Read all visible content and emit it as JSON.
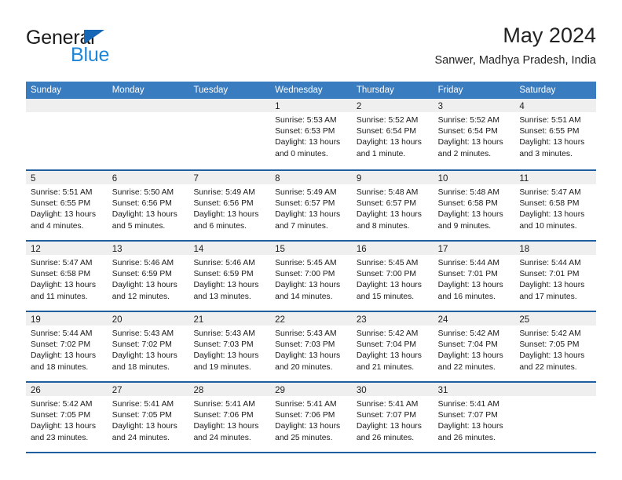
{
  "brand": {
    "name_part1": "General",
    "name_part2": "Blue",
    "triangle_color": "#1667b5",
    "blue_color": "#1e86d8"
  },
  "header": {
    "title": "May 2024",
    "subtitle": "Sanwer, Madhya Pradesh, India"
  },
  "theme": {
    "header_bg": "#3a7cc0",
    "row_border": "#1f5fa0",
    "day_band_bg": "#efefef"
  },
  "weekdays": [
    "Sunday",
    "Monday",
    "Tuesday",
    "Wednesday",
    "Thursday",
    "Friday",
    "Saturday"
  ],
  "weeks": [
    [
      {
        "day": "",
        "sunrise": "",
        "sunset": "",
        "daylight1": "",
        "daylight2": ""
      },
      {
        "day": "",
        "sunrise": "",
        "sunset": "",
        "daylight1": "",
        "daylight2": ""
      },
      {
        "day": "",
        "sunrise": "",
        "sunset": "",
        "daylight1": "",
        "daylight2": ""
      },
      {
        "day": "1",
        "sunrise": "Sunrise: 5:53 AM",
        "sunset": "Sunset: 6:53 PM",
        "daylight1": "Daylight: 13 hours",
        "daylight2": "and 0 minutes."
      },
      {
        "day": "2",
        "sunrise": "Sunrise: 5:52 AM",
        "sunset": "Sunset: 6:54 PM",
        "daylight1": "Daylight: 13 hours",
        "daylight2": "and 1 minute."
      },
      {
        "day": "3",
        "sunrise": "Sunrise: 5:52 AM",
        "sunset": "Sunset: 6:54 PM",
        "daylight1": "Daylight: 13 hours",
        "daylight2": "and 2 minutes."
      },
      {
        "day": "4",
        "sunrise": "Sunrise: 5:51 AM",
        "sunset": "Sunset: 6:55 PM",
        "daylight1": "Daylight: 13 hours",
        "daylight2": "and 3 minutes."
      }
    ],
    [
      {
        "day": "5",
        "sunrise": "Sunrise: 5:51 AM",
        "sunset": "Sunset: 6:55 PM",
        "daylight1": "Daylight: 13 hours",
        "daylight2": "and 4 minutes."
      },
      {
        "day": "6",
        "sunrise": "Sunrise: 5:50 AM",
        "sunset": "Sunset: 6:56 PM",
        "daylight1": "Daylight: 13 hours",
        "daylight2": "and 5 minutes."
      },
      {
        "day": "7",
        "sunrise": "Sunrise: 5:49 AM",
        "sunset": "Sunset: 6:56 PM",
        "daylight1": "Daylight: 13 hours",
        "daylight2": "and 6 minutes."
      },
      {
        "day": "8",
        "sunrise": "Sunrise: 5:49 AM",
        "sunset": "Sunset: 6:57 PM",
        "daylight1": "Daylight: 13 hours",
        "daylight2": "and 7 minutes."
      },
      {
        "day": "9",
        "sunrise": "Sunrise: 5:48 AM",
        "sunset": "Sunset: 6:57 PM",
        "daylight1": "Daylight: 13 hours",
        "daylight2": "and 8 minutes."
      },
      {
        "day": "10",
        "sunrise": "Sunrise: 5:48 AM",
        "sunset": "Sunset: 6:58 PM",
        "daylight1": "Daylight: 13 hours",
        "daylight2": "and 9 minutes."
      },
      {
        "day": "11",
        "sunrise": "Sunrise: 5:47 AM",
        "sunset": "Sunset: 6:58 PM",
        "daylight1": "Daylight: 13 hours",
        "daylight2": "and 10 minutes."
      }
    ],
    [
      {
        "day": "12",
        "sunrise": "Sunrise: 5:47 AM",
        "sunset": "Sunset: 6:58 PM",
        "daylight1": "Daylight: 13 hours",
        "daylight2": "and 11 minutes."
      },
      {
        "day": "13",
        "sunrise": "Sunrise: 5:46 AM",
        "sunset": "Sunset: 6:59 PM",
        "daylight1": "Daylight: 13 hours",
        "daylight2": "and 12 minutes."
      },
      {
        "day": "14",
        "sunrise": "Sunrise: 5:46 AM",
        "sunset": "Sunset: 6:59 PM",
        "daylight1": "Daylight: 13 hours",
        "daylight2": "and 13 minutes."
      },
      {
        "day": "15",
        "sunrise": "Sunrise: 5:45 AM",
        "sunset": "Sunset: 7:00 PM",
        "daylight1": "Daylight: 13 hours",
        "daylight2": "and 14 minutes."
      },
      {
        "day": "16",
        "sunrise": "Sunrise: 5:45 AM",
        "sunset": "Sunset: 7:00 PM",
        "daylight1": "Daylight: 13 hours",
        "daylight2": "and 15 minutes."
      },
      {
        "day": "17",
        "sunrise": "Sunrise: 5:44 AM",
        "sunset": "Sunset: 7:01 PM",
        "daylight1": "Daylight: 13 hours",
        "daylight2": "and 16 minutes."
      },
      {
        "day": "18",
        "sunrise": "Sunrise: 5:44 AM",
        "sunset": "Sunset: 7:01 PM",
        "daylight1": "Daylight: 13 hours",
        "daylight2": "and 17 minutes."
      }
    ],
    [
      {
        "day": "19",
        "sunrise": "Sunrise: 5:44 AM",
        "sunset": "Sunset: 7:02 PM",
        "daylight1": "Daylight: 13 hours",
        "daylight2": "and 18 minutes."
      },
      {
        "day": "20",
        "sunrise": "Sunrise: 5:43 AM",
        "sunset": "Sunset: 7:02 PM",
        "daylight1": "Daylight: 13 hours",
        "daylight2": "and 18 minutes."
      },
      {
        "day": "21",
        "sunrise": "Sunrise: 5:43 AM",
        "sunset": "Sunset: 7:03 PM",
        "daylight1": "Daylight: 13 hours",
        "daylight2": "and 19 minutes."
      },
      {
        "day": "22",
        "sunrise": "Sunrise: 5:43 AM",
        "sunset": "Sunset: 7:03 PM",
        "daylight1": "Daylight: 13 hours",
        "daylight2": "and 20 minutes."
      },
      {
        "day": "23",
        "sunrise": "Sunrise: 5:42 AM",
        "sunset": "Sunset: 7:04 PM",
        "daylight1": "Daylight: 13 hours",
        "daylight2": "and 21 minutes."
      },
      {
        "day": "24",
        "sunrise": "Sunrise: 5:42 AM",
        "sunset": "Sunset: 7:04 PM",
        "daylight1": "Daylight: 13 hours",
        "daylight2": "and 22 minutes."
      },
      {
        "day": "25",
        "sunrise": "Sunrise: 5:42 AM",
        "sunset": "Sunset: 7:05 PM",
        "daylight1": "Daylight: 13 hours",
        "daylight2": "and 22 minutes."
      }
    ],
    [
      {
        "day": "26",
        "sunrise": "Sunrise: 5:42 AM",
        "sunset": "Sunset: 7:05 PM",
        "daylight1": "Daylight: 13 hours",
        "daylight2": "and 23 minutes."
      },
      {
        "day": "27",
        "sunrise": "Sunrise: 5:41 AM",
        "sunset": "Sunset: 7:05 PM",
        "daylight1": "Daylight: 13 hours",
        "daylight2": "and 24 minutes."
      },
      {
        "day": "28",
        "sunrise": "Sunrise: 5:41 AM",
        "sunset": "Sunset: 7:06 PM",
        "daylight1": "Daylight: 13 hours",
        "daylight2": "and 24 minutes."
      },
      {
        "day": "29",
        "sunrise": "Sunrise: 5:41 AM",
        "sunset": "Sunset: 7:06 PM",
        "daylight1": "Daylight: 13 hours",
        "daylight2": "and 25 minutes."
      },
      {
        "day": "30",
        "sunrise": "Sunrise: 5:41 AM",
        "sunset": "Sunset: 7:07 PM",
        "daylight1": "Daylight: 13 hours",
        "daylight2": "and 26 minutes."
      },
      {
        "day": "31",
        "sunrise": "Sunrise: 5:41 AM",
        "sunset": "Sunset: 7:07 PM",
        "daylight1": "Daylight: 13 hours",
        "daylight2": "and 26 minutes."
      },
      {
        "day": "",
        "sunrise": "",
        "sunset": "",
        "daylight1": "",
        "daylight2": ""
      }
    ]
  ]
}
